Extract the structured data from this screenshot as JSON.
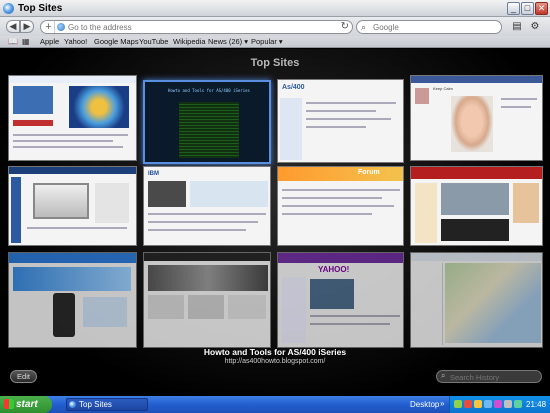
{
  "window": {
    "title": "Top Sites",
    "controls": {
      "minimize": "_",
      "maximize": "□",
      "close": "✕"
    }
  },
  "toolbar": {
    "address_placeholder": "Go to the address",
    "search_placeholder": "Google"
  },
  "bookmarks": {
    "items": [
      {
        "label": "Apple"
      },
      {
        "label": "Yahoo!"
      },
      {
        "label": "Google Maps"
      },
      {
        "label": "YouTube"
      },
      {
        "label": "Wikipedia"
      },
      {
        "label": "News (26) ▾"
      },
      {
        "label": "Popular ▾"
      }
    ]
  },
  "topsites": {
    "heading": "Top Sites",
    "selected_title": "Howto and Tools for AS/400 iSeries",
    "selected_url": "http://as400howto.blogspot.com/",
    "edit_label": "Edit",
    "search_history_placeholder": "Search History",
    "thumb_texts": {
      "t1": "Howto and Tools for AS/400 iSeries",
      "t2": "As/400",
      "t3": "Keep Calm",
      "t4": "IBM",
      "t5": "Forum",
      "t6": "YAHOO!"
    }
  },
  "taskbar": {
    "start_label": "start",
    "task_label": "Top Sites",
    "desktop_label": "Desktop",
    "clock": "21:48"
  }
}
